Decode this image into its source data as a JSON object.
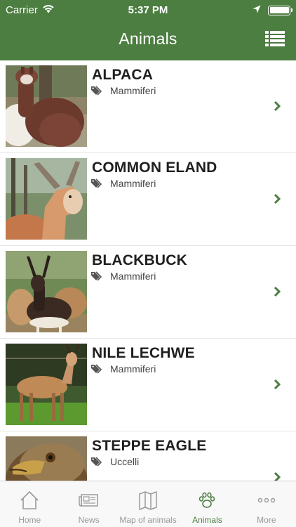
{
  "status_bar": {
    "carrier": "Carrier",
    "time": "5:37 PM"
  },
  "nav": {
    "title": "Animals"
  },
  "colors": {
    "brand": "#4c7d41",
    "tab_inactive": "#9a9a9a"
  },
  "animals": [
    {
      "name": "ALPACA",
      "category": "Mammiferi"
    },
    {
      "name": "COMMON ELAND",
      "category": "Mammiferi"
    },
    {
      "name": "BLACKBUCK",
      "category": "Mammiferi"
    },
    {
      "name": "NILE LECHWE",
      "category": "Mammiferi"
    },
    {
      "name": "STEPPE EAGLE",
      "category": "Uccelli"
    }
  ],
  "tabs": [
    {
      "label": "Home",
      "icon": "home-icon",
      "active": false
    },
    {
      "label": "News",
      "icon": "newspaper-icon",
      "active": false
    },
    {
      "label": "Map of animals",
      "icon": "map-icon",
      "active": false
    },
    {
      "label": "Animals",
      "icon": "paw-icon",
      "active": true
    },
    {
      "label": "More",
      "icon": "more-icon",
      "active": false
    }
  ]
}
